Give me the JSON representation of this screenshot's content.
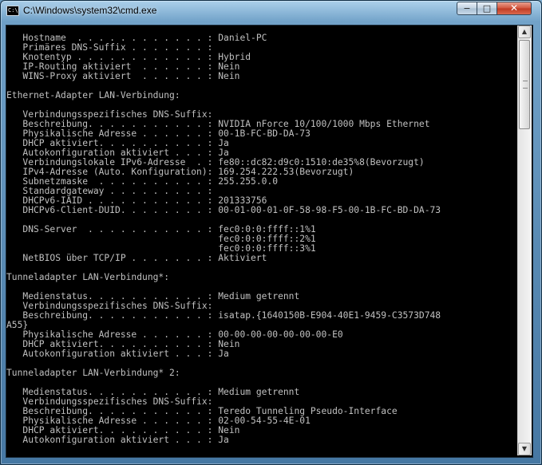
{
  "window": {
    "title": "C:\\Windows\\system32\\cmd.exe",
    "icon_text": "C:\\",
    "buttons": {
      "minimize": "−",
      "maximize": "□",
      "close": "✕"
    }
  },
  "console": {
    "lines": [
      "   Hostname  . . . . . . . . . . . . : Daniel-PC",
      "   Primäres DNS-Suffix . . . . . . . :",
      "   Knotentyp . . . . . . . . . . . . : Hybrid",
      "   IP-Routing aktiviert  . . . . . . : Nein",
      "   WINS-Proxy aktiviert  . . . . . . : Nein",
      "",
      "Ethernet-Adapter LAN-Verbindung:",
      "",
      "   Verbindungsspezifisches DNS-Suffix:",
      "   Beschreibung. . . . . . . . . . . : NVIDIA nForce 10/100/1000 Mbps Ethernet",
      "   Physikalische Adresse . . . . . . : 00-1B-FC-BD-DA-73",
      "   DHCP aktiviert. . . . . . . . . . : Ja",
      "   Autokonfiguration aktiviert . . . : Ja",
      "   Verbindungslokale IPv6-Adresse  . : fe80::dc82:d9c0:1510:de35%8(Bevorzugt)",
      "   IPv4-Adresse (Auto. Konfiguration): 169.254.222.53(Bevorzugt)",
      "   Subnetzmaske  . . . . . . . . . . : 255.255.0.0",
      "   Standardgateway . . . . . . . . . :",
      "   DHCPv6-IAID . . . . . . . . . . . : 201333756",
      "   DHCPv6-Client-DUID. . . . . . . . : 00-01-00-01-0F-58-98-F5-00-1B-FC-BD-DA-73",
      "",
      "   DNS-Server  . . . . . . . . . . . : fec0:0:0:ffff::1%1",
      "                                       fec0:0:0:ffff::2%1",
      "                                       fec0:0:0:ffff::3%1",
      "   NetBIOS über TCP/IP . . . . . . . : Aktiviert",
      "",
      "Tunneladapter LAN-Verbindung*:",
      "",
      "   Medienstatus. . . . . . . . . . . : Medium getrennt",
      "   Verbindungsspezifisches DNS-Suffix:",
      "   Beschreibung. . . . . . . . . . . : isatap.{1640150B-E904-40E1-9459-C3573D748",
      "A55}",
      "   Physikalische Adresse . . . . . . : 00-00-00-00-00-00-00-E0",
      "   DHCP aktiviert. . . . . . . . . . : Nein",
      "   Autokonfiguration aktiviert . . . : Ja",
      "",
      "Tunneladapter LAN-Verbindung* 2:",
      "",
      "   Medienstatus. . . . . . . . . . . : Medium getrennt",
      "   Verbindungsspezifisches DNS-Suffix:",
      "   Beschreibung. . . . . . . . . . . : Teredo Tunneling Pseudo-Interface",
      "   Physikalische Adresse . . . . . . : 02-00-54-55-4E-01",
      "   DHCP aktiviert. . . . . . . . . . : Nein",
      "   Autokonfiguration aktiviert . . . : Ja"
    ]
  },
  "scrollbar": {
    "up_arrow_icon": "scroll-up-arrow-icon",
    "down_arrow_icon": "scroll-down-arrow-icon"
  }
}
